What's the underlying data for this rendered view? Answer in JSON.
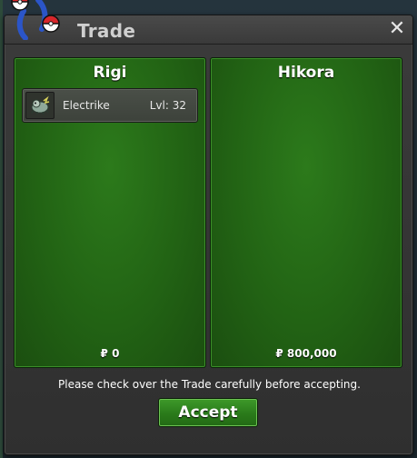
{
  "window": {
    "title": "Trade",
    "close_icon": "close-icon"
  },
  "trade": {
    "left": {
      "name": "Rigi",
      "items": [
        {
          "icon": "electrike-icon",
          "name": "Electrike",
          "level": "Lvl: 32"
        }
      ],
      "money": "₽ 0"
    },
    "right": {
      "name": "Hikora",
      "items": [],
      "money": "₽ 800,000"
    }
  },
  "footer": {
    "notice": "Please check over the Trade carefully before accepting.",
    "accept_label": "Accept"
  },
  "colors": {
    "panel_green": "#226314",
    "accept_green": "#2a7a1a"
  }
}
